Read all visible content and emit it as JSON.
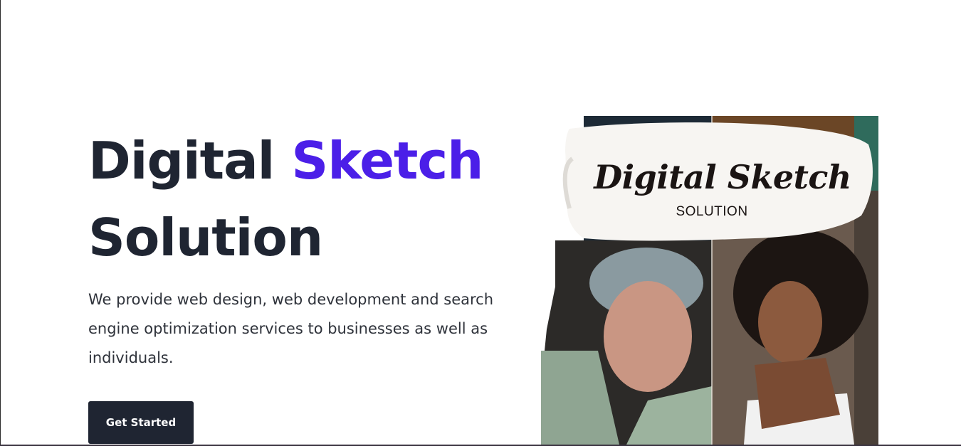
{
  "hero": {
    "title_part1": "Digital ",
    "title_accent": "Sketch",
    "title_part2": "Solution",
    "description": "We provide web design, web development and search engine optimization services to businesses as well as individuals.",
    "cta_label": "Get Started"
  },
  "hero_image": {
    "overlay_title": "Digital Sketch",
    "overlay_subtitle": "SOLUTION"
  },
  "colors": {
    "heading": "#1f2532",
    "accent": "#4b1fe8",
    "body_text": "#2e323a",
    "button_bg": "#1f2532",
    "button_text": "#ffffff"
  }
}
